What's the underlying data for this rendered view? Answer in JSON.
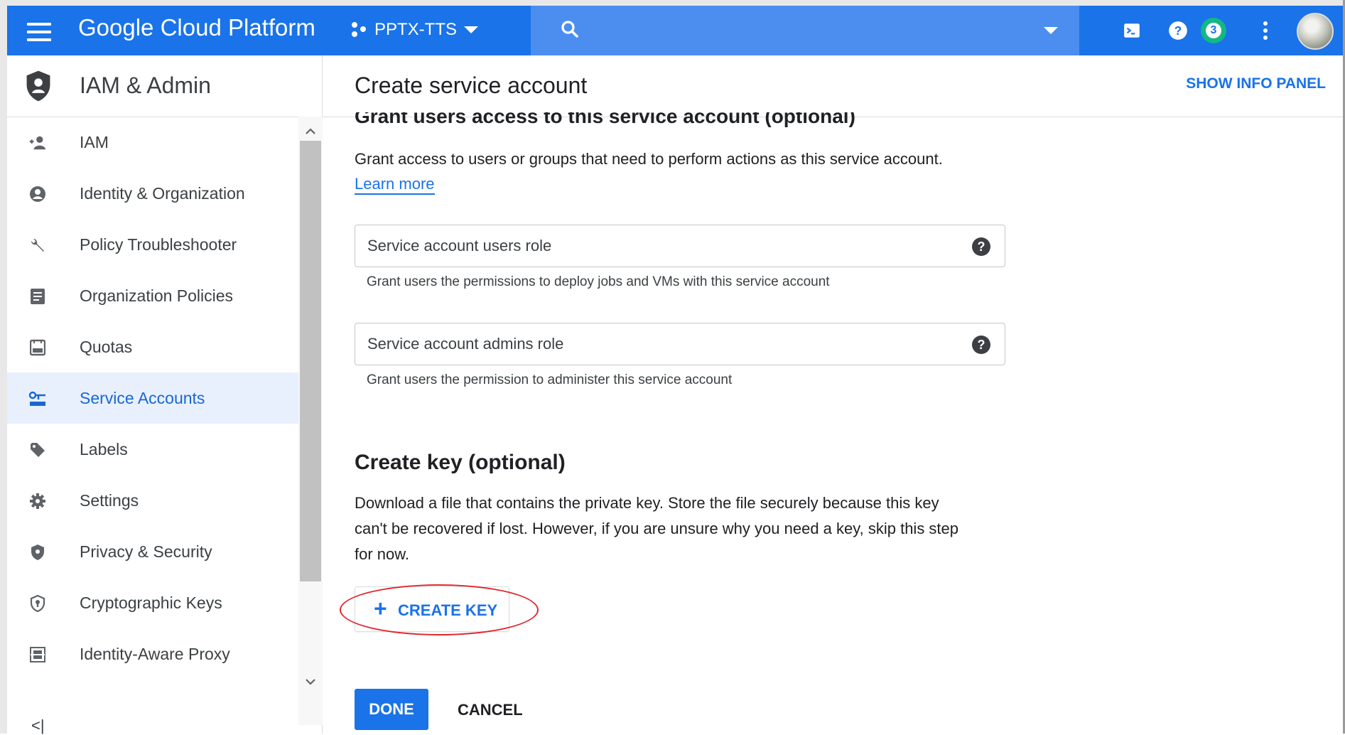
{
  "topbar": {
    "brand": "Google Cloud Platform",
    "project": "PPTX-TTS",
    "notifications_count": "3",
    "color": "#1a73e8"
  },
  "sidebar": {
    "title": "IAM & Admin",
    "items": [
      {
        "label": "IAM",
        "icon": "person-add-icon"
      },
      {
        "label": "Identity & Organization",
        "icon": "account-circle-icon"
      },
      {
        "label": "Policy Troubleshooter",
        "icon": "wrench-icon"
      },
      {
        "label": "Organization Policies",
        "icon": "document-list-icon"
      },
      {
        "label": "Quotas",
        "icon": "quota-icon"
      },
      {
        "label": "Service Accounts",
        "icon": "service-account-icon",
        "active": true
      },
      {
        "label": "Labels",
        "icon": "label-tag-icon"
      },
      {
        "label": "Settings",
        "icon": "gear-icon"
      },
      {
        "label": "Privacy & Security",
        "icon": "shield-icon"
      },
      {
        "label": "Cryptographic Keys",
        "icon": "key-shield-icon"
      },
      {
        "label": "Identity-Aware Proxy",
        "icon": "proxy-icon"
      }
    ],
    "collapse_label": "<|"
  },
  "main": {
    "title": "Create service account",
    "info_panel_label": "SHOW INFO PANEL",
    "grant_section": {
      "heading": "Grant users access to this service account (optional)",
      "description": "Grant access to users or groups that need to perform actions as this service account.",
      "learn_more": "Learn more",
      "users_role": {
        "value": "Service account users role",
        "hint": "Grant users the permissions to deploy jobs and VMs with this service account"
      },
      "admins_role": {
        "value": "Service account admins role",
        "hint": "Grant users the permission to administer this service account"
      }
    },
    "key_section": {
      "heading": "Create key (optional)",
      "description_lines": [
        "Download a file that contains the private key. Store the file securely because this key",
        "can't be recovered if lost. However, if you are unsure why you need a key, skip this step",
        "for now."
      ],
      "create_key_label": "CREATE KEY"
    },
    "done_label": "DONE",
    "cancel_label": "CANCEL"
  }
}
